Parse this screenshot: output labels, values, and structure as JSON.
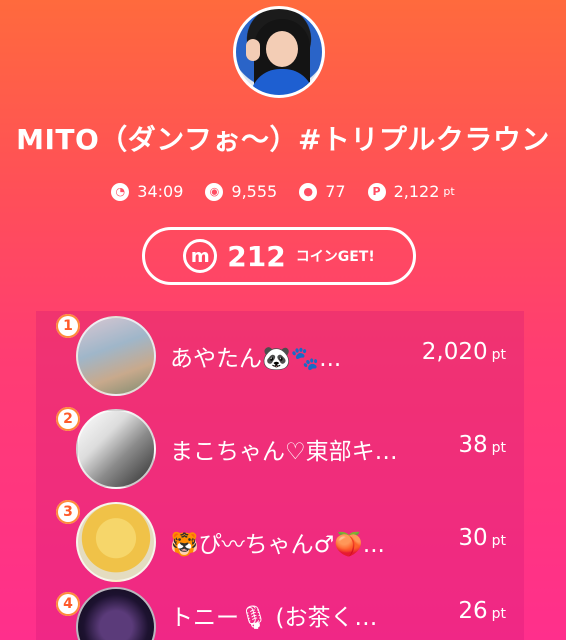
{
  "profile": {
    "name": "MITO（ダンフぉ〜）#トリプルクラウン"
  },
  "stats": {
    "time": "34:09",
    "viewers": "9,555",
    "comments": "77",
    "points": "2,122",
    "points_unit": "pt"
  },
  "coin_button": {
    "icon": "m",
    "amount": "212",
    "suffix": "コインGET!"
  },
  "ranking": [
    {
      "rank": "1",
      "name": "あやたん🐼🐾...",
      "points": "2,020",
      "unit": "pt"
    },
    {
      "rank": "2",
      "name": "まこちゃん♡東部キ…",
      "points": "38",
      "unit": "pt"
    },
    {
      "rank": "3",
      "name": "🐯ぴ〰ちゃん♂🍑...",
      "points": "30",
      "unit": "pt"
    },
    {
      "rank": "4",
      "name": "トニー🎙 (お茶くみ係) 🎙",
      "points": "26",
      "unit": "pt"
    }
  ],
  "icons": {
    "time": "clock-icon",
    "viewers": "viewers-icon",
    "comments": "comment-icon",
    "points": "points-icon"
  }
}
